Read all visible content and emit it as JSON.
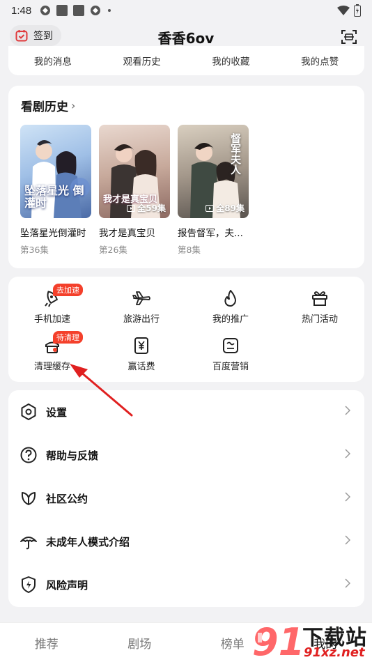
{
  "status_bar": {
    "time": "1:48"
  },
  "header": {
    "checkin_label": "签到",
    "title": "香香6ov"
  },
  "quick_links": [
    "我的消息",
    "观看历史",
    "我的收藏",
    "我的点赞"
  ],
  "history": {
    "title": "看剧历史",
    "items": [
      {
        "name": "坠落星光倒灌时",
        "episode": "第36集",
        "total": "",
        "poster_text": "坠落星光 倒灌时"
      },
      {
        "name": "我才是真宝贝",
        "episode": "第26集",
        "total": "全59集",
        "poster_text": "我才是真宝贝"
      },
      {
        "name": "报告督军，夫...",
        "episode": "第8集",
        "total": "全89集",
        "poster_text": "督军夫人"
      }
    ]
  },
  "tools": [
    {
      "label": "手机加速",
      "badge": "去加速",
      "icon": "rocket-icon"
    },
    {
      "label": "旅游出行",
      "badge": "",
      "icon": "airplane-icon"
    },
    {
      "label": "我的推广",
      "badge": "",
      "icon": "flame-icon"
    },
    {
      "label": "热门活动",
      "badge": "",
      "icon": "gift-icon"
    },
    {
      "label": "清理缓存",
      "badge": "待清理",
      "icon": "broom-icon"
    },
    {
      "label": "赢话费",
      "badge": "",
      "icon": "yen-card-icon"
    },
    {
      "label": "百度营销",
      "badge": "",
      "icon": "chart-card-icon"
    }
  ],
  "menu": [
    {
      "label": "设置",
      "icon": "settings-icon"
    },
    {
      "label": "帮助与反馈",
      "icon": "help-icon"
    },
    {
      "label": "社区公约",
      "icon": "leaf-icon"
    },
    {
      "label": "未成年人模式介绍",
      "icon": "umbrella-icon"
    },
    {
      "label": "风险声明",
      "icon": "shield-icon"
    }
  ],
  "bottom_nav": [
    "推荐",
    "剧场",
    "榜单",
    "我的"
  ],
  "watermark": {
    "main": "下载站",
    "url": "91xz.net",
    "logo": "91"
  },
  "colors": {
    "badge": "#f4402b",
    "annotation_arrow": "#e02020",
    "accent": "#ff4d4f"
  }
}
